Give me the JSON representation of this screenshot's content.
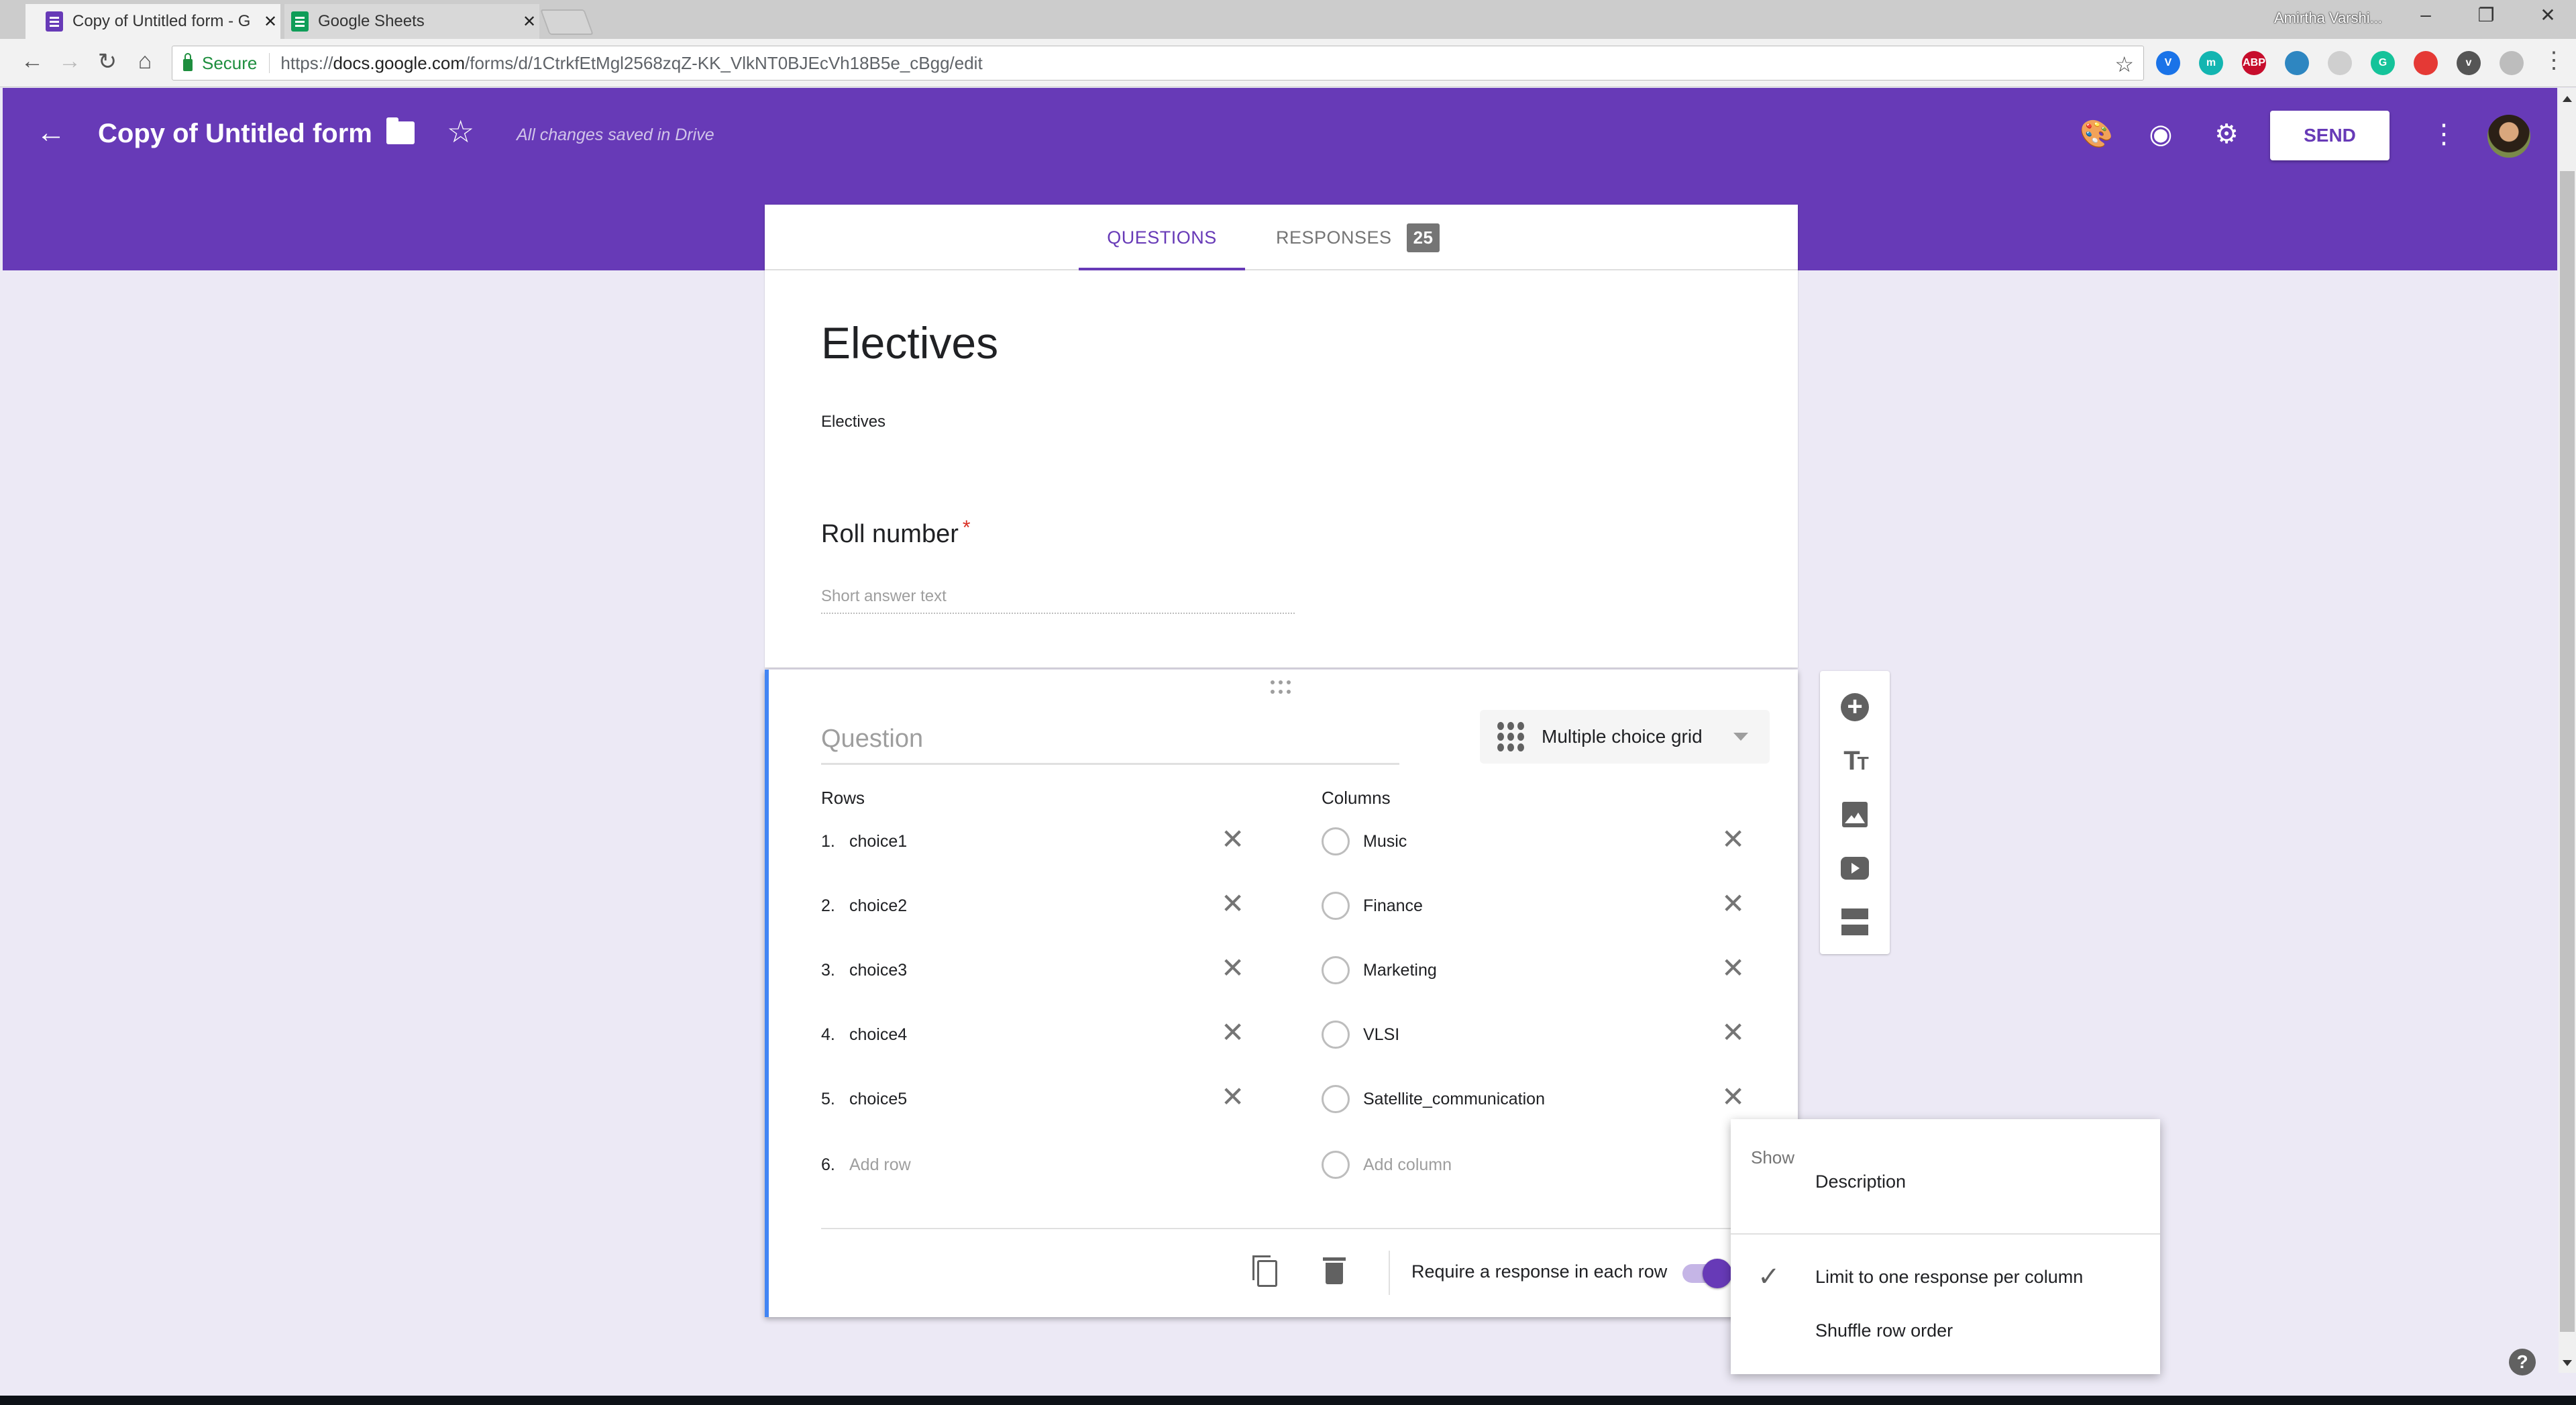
{
  "browser": {
    "tabs": [
      {
        "title": "Copy of Untitled form - G",
        "favicon": "google-forms-icon",
        "color": "#673ab7",
        "active": true
      },
      {
        "title": "Google Sheets",
        "favicon": "google-sheets-icon",
        "color": "#0f9d58",
        "active": false
      }
    ],
    "profile_name": "Amirtha Varshi...",
    "secure_label": "Secure",
    "url_prefix": "https://",
    "url_host": "docs.google.com",
    "url_path": "/forms/d/1CtrkfEtMgl2568zqZ-KK_VlkNT0BJEcVh18B5e_cBgg/edit",
    "extensions": [
      {
        "name": "vimeo-ext-icon",
        "label": "V",
        "color": "#1a73e8"
      },
      {
        "name": "mendeley-ext-icon",
        "label": "m",
        "color": "#13b5b1"
      },
      {
        "name": "adblock-plus-ext-icon",
        "label": "ABP",
        "color": "#c70d2c"
      },
      {
        "name": "eye-ext-icon",
        "label": "",
        "color": "#2e86c1"
      },
      {
        "name": "circle-ext-icon",
        "label": "",
        "color": "#cfcfcf"
      },
      {
        "name": "grammarly-ext-icon",
        "label": "G",
        "color": "#15c39a"
      },
      {
        "name": "gear-ext-icon",
        "label": "",
        "color": "#e53935"
      },
      {
        "name": "pocket-ext-icon",
        "label": "v",
        "color": "#555555"
      },
      {
        "name": "page-ext-icon",
        "label": "",
        "color": "#bdbdbd"
      }
    ]
  },
  "header": {
    "form_title": "Copy of Untitled form",
    "save_status": "All changes saved in Drive",
    "send_label": "SEND",
    "accent": "#673ab7"
  },
  "form_tabs": {
    "questions": "QUESTIONS",
    "responses": "RESPONSES",
    "response_count": "25"
  },
  "form": {
    "title": "Electives",
    "description": "Electives",
    "questions": [
      {
        "title": "Roll number",
        "required_mark": "*",
        "placeholder": "Short answer text"
      }
    ]
  },
  "editing_question": {
    "placeholder": "Question",
    "type": "Multiple choice grid",
    "rows_label": "Rows",
    "columns_label": "Columns",
    "rows": [
      {
        "num": "1.",
        "label": "choice1"
      },
      {
        "num": "2.",
        "label": "choice2"
      },
      {
        "num": "3.",
        "label": "choice3"
      },
      {
        "num": "4.",
        "label": "choice4"
      },
      {
        "num": "5.",
        "label": "choice5"
      }
    ],
    "add_row": {
      "num": "6.",
      "label": "Add row"
    },
    "columns": [
      "Music",
      "Finance",
      "Marketing",
      "VLSI",
      "Satellite_communication"
    ],
    "add_column": "Add column",
    "require_label": "Require a response in each row",
    "require_on": true
  },
  "menu": {
    "header": "Show",
    "items": [
      {
        "label": "Description",
        "checked": false
      },
      {
        "label": "Limit to one response per column",
        "checked": true
      },
      {
        "label": "Shuffle row order",
        "checked": false
      }
    ],
    "check_glyph": "✓"
  },
  "help_glyph": "?"
}
